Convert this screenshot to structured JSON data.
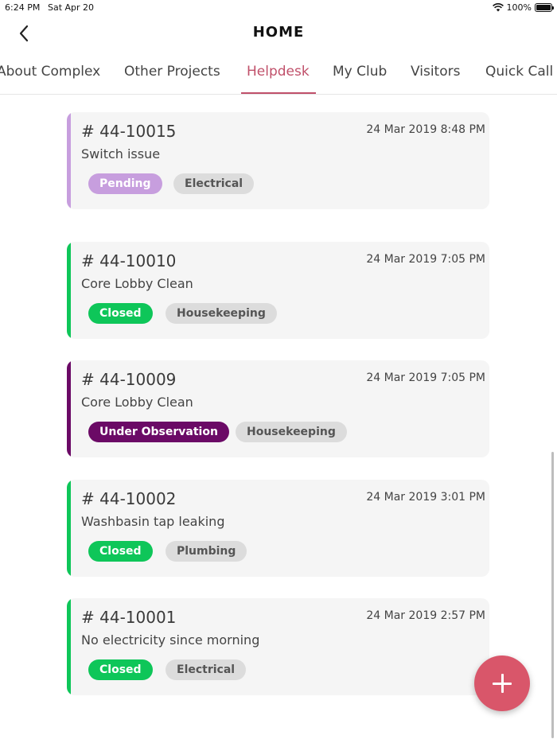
{
  "status_bar": {
    "time": "6:24 PM",
    "date": "Sat Apr 20",
    "battery": "100%"
  },
  "header": {
    "title": "HOME",
    "back_icon": "chevron-left-icon"
  },
  "tabs": [
    {
      "label": "About Complex",
      "active": false
    },
    {
      "label": "Other Projects",
      "active": false
    },
    {
      "label": "Helpdesk",
      "active": true
    },
    {
      "label": "My Club",
      "active": false
    },
    {
      "label": "Visitors",
      "active": false
    },
    {
      "label": "Quick Call",
      "active": false
    }
  ],
  "colors": {
    "accent": "#c0506a",
    "fab": "#d9566a",
    "pending": "#c79ede",
    "closed": "#0ec659",
    "under_observation": "#6b0a66",
    "category_badge": "#dcdcdc"
  },
  "tickets": [
    {
      "number": "# 44-10015",
      "date": "24 Mar 2019 8:48 PM",
      "title": "Switch issue",
      "status": "Pending",
      "status_color": "#c79ede",
      "category": "Electrical"
    },
    {
      "number": "# 44-10010",
      "date": "24 Mar 2019 7:05 PM",
      "title": "Core Lobby Clean",
      "status": "Closed",
      "status_color": "#0ec659",
      "category": "Housekeeping"
    },
    {
      "number": "# 44-10009",
      "date": "24 Mar 2019 7:05 PM",
      "title": "Core Lobby Clean",
      "status": "Under Observation",
      "status_color": "#6b0a66",
      "category": "Housekeeping"
    },
    {
      "number": "# 44-10002",
      "date": "24 Mar 2019 3:01 PM",
      "title": "Washbasin tap leaking",
      "status": "Closed",
      "status_color": "#0ec659",
      "category": "Plumbing"
    },
    {
      "number": "# 44-10001",
      "date": "24 Mar 2019 2:57 PM",
      "title": "No electricity since morning",
      "status": "Closed",
      "status_color": "#0ec659",
      "category": "Electrical"
    }
  ],
  "fab": {
    "icon": "plus-icon"
  }
}
